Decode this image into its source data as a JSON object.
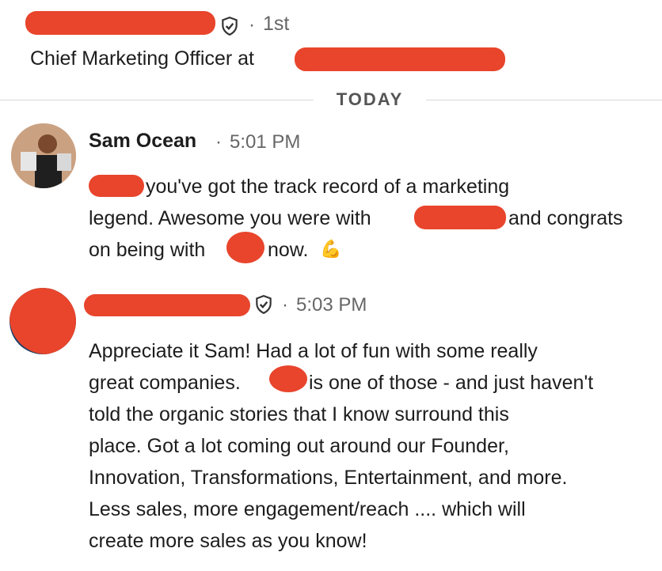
{
  "header": {
    "connection_degree": "1st",
    "separator": "·",
    "title_prefix": "Chief Marketing Officer at"
  },
  "divider_label": "TODAY",
  "messages": [
    {
      "sender": "Sam Ocean",
      "separator": "·",
      "time": "5:01 PM",
      "lines": {
        "l1": "you've got the track record of a marketing",
        "l2a": "legend. Awesome you were with",
        "l2b": "and congrats",
        "l3a": "on being with",
        "l3b": "now.",
        "emoji": "💪"
      }
    },
    {
      "separator": "·",
      "time": "5:03 PM",
      "lines": {
        "l1": "Appreciate it Sam! Had a lot of fun with some really",
        "l2a": "great companies.",
        "l2b": "is one of those - and just haven't",
        "l3": "told the organic stories that I know surround this",
        "l4": "place. Got a lot coming out around our Founder,",
        "l5": "Innovation, Transformations, Entertainment, and more.",
        "l6": "Less sales, more engagement/reach .... which will",
        "l7": "create more sales as you know!"
      }
    }
  ],
  "colors": {
    "redaction": "#e8452c",
    "divider": "#d9d9d9",
    "muted": "#666666"
  }
}
